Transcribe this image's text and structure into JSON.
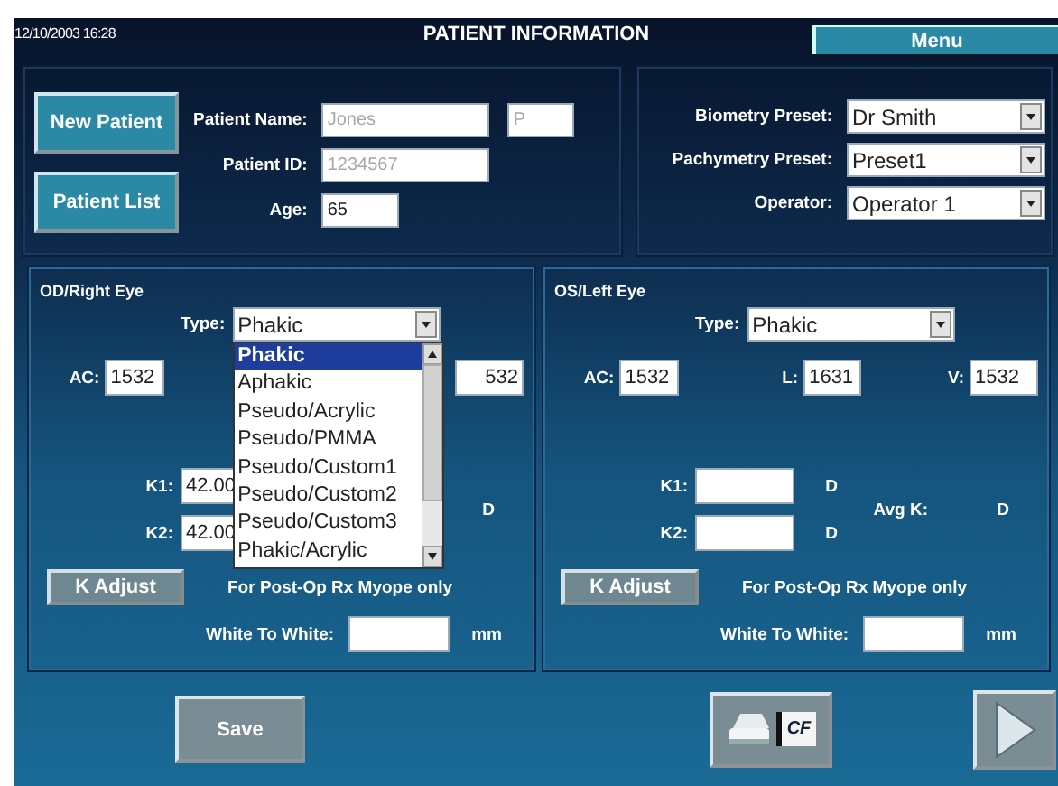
{
  "header": {
    "datetime": "12/10/2003 16:28",
    "title": "PATIENT INFORMATION",
    "menu_button": "Menu"
  },
  "patient": {
    "buttons": [
      "New Patient",
      "Patient List"
    ],
    "fields": [
      {
        "label": "Patient Name:",
        "values": [
          "Jones",
          "P"
        ],
        "disabled": true
      },
      {
        "label": "Patient ID:",
        "values": [
          "1234567"
        ],
        "disabled": true
      },
      {
        "label": "Age:",
        "values": [
          "65"
        ],
        "disabled": false
      }
    ]
  },
  "presets": [
    {
      "label": "Biometry Preset:",
      "value": "Dr Smith"
    },
    {
      "label": "Pachymetry Preset:",
      "value": "Preset1"
    },
    {
      "label": "Operator:",
      "value": "Operator 1"
    }
  ],
  "eyes": [
    {
      "title": "OD/Right Eye",
      "type_label": "Type:",
      "type_value": "Phakic",
      "type_options": [
        {
          "label": "Phakic",
          "selected": true
        },
        {
          "label": "Aphakic",
          "selected": false
        },
        {
          "label": "Pseudo/Acrylic",
          "selected": false
        },
        {
          "label": "Pseudo/PMMA",
          "selected": false
        },
        {
          "label": "Pseudo/Custom1",
          "selected": false
        },
        {
          "label": "Pseudo/Custom2",
          "selected": false
        },
        {
          "label": "Pseudo/Custom3",
          "selected": false
        },
        {
          "label": "Phakic/Acrylic",
          "selected": false
        }
      ],
      "ac": {
        "label": "AC:",
        "value": "1532"
      },
      "v": {
        "value": "532"
      },
      "k1": {
        "label": "K1:",
        "value": "42.00"
      },
      "k2": {
        "label": "K2:",
        "value": "42.00"
      },
      "avg": {
        "unit": "D"
      },
      "k_adjust": "K Adjust",
      "note": "For Post-Op Rx Myope only",
      "wtw_label": "White To White:",
      "wtw_unit": "mm"
    },
    {
      "title": "OS/Left Eye",
      "type_label": "Type:",
      "type_value": "Phakic",
      "ac": {
        "label": "AC:",
        "value": "1532"
      },
      "l": {
        "label": "L:",
        "value": "1631"
      },
      "v": {
        "label": "V:",
        "value": "1532"
      },
      "k1": {
        "label": "K1:",
        "unit": "D"
      },
      "k2": {
        "label": "K2:",
        "unit": "D"
      },
      "avg": {
        "label": "Avg K:",
        "unit": "D"
      },
      "k_adjust": "K Adjust",
      "note": "For Post-Op Rx Myope only",
      "wtw_label": "White To White:",
      "wtw_unit": "mm"
    }
  ],
  "footer": {
    "save_button": "Save",
    "print_button": "CF"
  }
}
